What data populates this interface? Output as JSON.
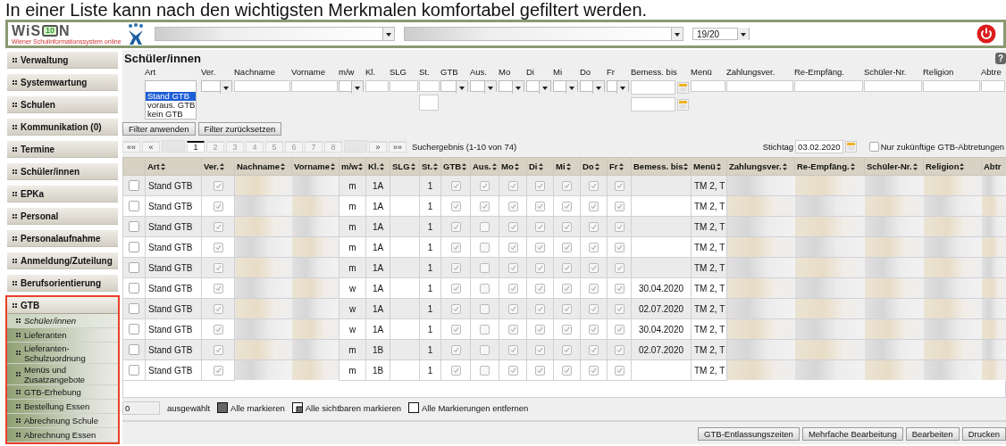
{
  "caption": "In einer Liste kann nach den wichtigsten Merkmalen komfortabel gefiltert werden.",
  "header": {
    "logo": {
      "prefix": "WiS",
      "badge": "10",
      "suffix": "N",
      "tagline": "Wiener Schulinformationssystem online"
    },
    "year": "19/20"
  },
  "sidebar": {
    "items": [
      {
        "label": "Verwaltung",
        "highlighted": false
      },
      {
        "label": "Systemwartung",
        "highlighted": false
      },
      {
        "label": "Schulen",
        "highlighted": false
      },
      {
        "label": "Kommunikation (0)",
        "highlighted": false
      },
      {
        "label": "Termine",
        "highlighted": false
      },
      {
        "label": "Schüler/innen",
        "highlighted": false
      },
      {
        "label": "EPKa",
        "highlighted": false
      },
      {
        "label": "Personal",
        "highlighted": false
      },
      {
        "label": "Personalaufnahme",
        "highlighted": false
      },
      {
        "label": "Anmeldung/Zuteilung",
        "highlighted": false
      },
      {
        "label": "Berufsorientierung",
        "highlighted": false
      },
      {
        "label": "GTB",
        "highlighted": true,
        "expanded": true,
        "children": [
          {
            "label": "Schüler/innen",
            "selected": true
          },
          {
            "label": "Lieferanten",
            "selected": false
          },
          {
            "label": "Lieferanten-Schulzuordnung",
            "selected": false
          },
          {
            "label": "Menüs und Zusatzangebote",
            "selected": false
          },
          {
            "label": "GTB-Erhebung",
            "selected": false
          },
          {
            "label": "Bestellung Essen",
            "selected": false
          },
          {
            "label": "Abrechnung Schule",
            "selected": false
          },
          {
            "label": "Abrechnung Essen",
            "selected": false
          }
        ]
      }
    ]
  },
  "page_title": "Schüler/innen",
  "help": "?",
  "filters": [
    {
      "label": "Art",
      "kind": "listbox",
      "options": [
        {
          "label": "Stand GTB",
          "selected": true
        },
        {
          "label": "voraus. GTB",
          "selected": false
        },
        {
          "label": "kein GTB",
          "selected": false
        }
      ]
    },
    {
      "label": "Ver.",
      "kind": "select"
    },
    {
      "label": "Nachname",
      "kind": "text"
    },
    {
      "label": "Vorname",
      "kind": "text"
    },
    {
      "label": "m/w",
      "kind": "select"
    },
    {
      "label": "Kl.",
      "kind": "text"
    },
    {
      "label": "SLG",
      "kind": "text"
    },
    {
      "label": "St.",
      "kind": "text_pair"
    },
    {
      "label": "GTB",
      "kind": "select"
    },
    {
      "label": "Aus.",
      "kind": "select"
    },
    {
      "label": "Mo",
      "kind": "select"
    },
    {
      "label": "Di",
      "kind": "select"
    },
    {
      "label": "Mi",
      "kind": "select"
    },
    {
      "label": "Do",
      "kind": "select"
    },
    {
      "label": "Fr",
      "kind": "select"
    },
    {
      "label": "Bemess. bis",
      "kind": "date_pair"
    },
    {
      "label": "Menü",
      "kind": "text"
    },
    {
      "label": "Zahlungsver.",
      "kind": "text"
    },
    {
      "label": "Re-Empfäng.",
      "kind": "text"
    },
    {
      "label": "Schüler-Nr.",
      "kind": "text"
    },
    {
      "label": "Religion",
      "kind": "text"
    },
    {
      "label": "Abtre",
      "kind": "text"
    }
  ],
  "filter_buttons": [
    "Filter anwenden",
    "Filter zurücksetzen"
  ],
  "pagination": {
    "first": "««",
    "prev": "«",
    "pages": [
      {
        "label": "1",
        "selected": true
      },
      {
        "label": "2",
        "selected": false
      },
      {
        "label": "3",
        "selected": false
      },
      {
        "label": "4",
        "selected": false
      },
      {
        "label": "5",
        "selected": false
      },
      {
        "label": "6",
        "selected": false
      },
      {
        "label": "7",
        "selected": false
      },
      {
        "label": "8",
        "selected": false
      }
    ],
    "next": "»",
    "last": "»»",
    "result": "Suchergebnis (1-10 von 74)"
  },
  "stichtag": {
    "label": "Stichtag",
    "value": "03.02.2020"
  },
  "future_only": {
    "label": "Nur zukünftige GTB-Abtretungen",
    "checked": false
  },
  "table": {
    "columns": [
      {
        "label": "Art",
        "kind": "text",
        "sortable": true
      },
      {
        "label": "Ver.",
        "kind": "check",
        "sortable": true
      },
      {
        "label": "Nachname",
        "kind": "blurred",
        "sortable": true
      },
      {
        "label": "Vorname",
        "kind": "blurred",
        "sortable": true
      },
      {
        "label": "m/w",
        "kind": "text",
        "sortable": true
      },
      {
        "label": "Kl.",
        "kind": "text",
        "sortable": true
      },
      {
        "label": "SLG",
        "kind": "text",
        "sortable": true
      },
      {
        "label": "St.",
        "kind": "text",
        "sortable": true
      },
      {
        "label": "GTB",
        "kind": "check",
        "sortable": true
      },
      {
        "label": "Aus.",
        "kind": "check",
        "sortable": true
      },
      {
        "label": "Mo",
        "kind": "check",
        "sortable": true
      },
      {
        "label": "Di",
        "kind": "check",
        "sortable": true
      },
      {
        "label": "Mi",
        "kind": "check",
        "sortable": true
      },
      {
        "label": "Do",
        "kind": "check",
        "sortable": true
      },
      {
        "label": "Fr",
        "kind": "check",
        "sortable": true
      },
      {
        "label": "Bemess. bis",
        "kind": "text",
        "sortable": true
      },
      {
        "label": "Menü",
        "kind": "text",
        "sortable": true
      },
      {
        "label": "Zahlungsver.",
        "kind": "blurred",
        "sortable": true
      },
      {
        "label": "Re-Empfäng.",
        "kind": "blurred",
        "sortable": true
      },
      {
        "label": "Schüler-Nr.",
        "kind": "blurred",
        "sortable": true
      },
      {
        "label": "Religion",
        "kind": "blurred",
        "sortable": true
      },
      {
        "label": "Abtr",
        "kind": "blurred"
      }
    ],
    "rows": [
      {
        "selected": false,
        "art": "Stand GTB",
        "ver": true,
        "mw": "m",
        "kl": "1A",
        "st": "1",
        "gtb": true,
        "aus": true,
        "mo": true,
        "di": true,
        "mi": true,
        "do": true,
        "fr": true,
        "menu": "TM 2, T"
      },
      {
        "selected": false,
        "art": "Stand GTB",
        "ver": true,
        "mw": "m",
        "kl": "1A",
        "st": "1",
        "gtb": true,
        "aus": true,
        "mo": true,
        "di": true,
        "mi": true,
        "do": true,
        "fr": true,
        "menu": "TM 2, T"
      },
      {
        "selected": false,
        "art": "Stand GTB",
        "ver": true,
        "mw": "m",
        "kl": "1A",
        "st": "1",
        "gtb": true,
        "aus": false,
        "mo": true,
        "di": true,
        "mi": true,
        "do": true,
        "fr": true,
        "menu": "TM 2, T"
      },
      {
        "selected": false,
        "art": "Stand GTB",
        "ver": true,
        "mw": "m",
        "kl": "1A",
        "st": "1",
        "gtb": true,
        "aus": false,
        "mo": true,
        "di": true,
        "mi": true,
        "do": true,
        "fr": true,
        "menu": "TM 2, T"
      },
      {
        "selected": false,
        "art": "Stand GTB",
        "ver": true,
        "mw": "m",
        "kl": "1A",
        "st": "1",
        "gtb": true,
        "aus": false,
        "mo": true,
        "di": true,
        "mi": true,
        "do": true,
        "fr": true,
        "menu": "TM 2, T"
      },
      {
        "selected": false,
        "art": "Stand GTB",
        "ver": true,
        "mw": "w",
        "kl": "1A",
        "st": "1",
        "gtb": true,
        "aus": false,
        "mo": true,
        "di": true,
        "mi": true,
        "do": true,
        "fr": true,
        "bemess": "30.04.2020",
        "menu": "TM 2, T"
      },
      {
        "selected": false,
        "art": "Stand GTB",
        "ver": true,
        "mw": "w",
        "kl": "1A",
        "st": "1",
        "gtb": true,
        "aus": false,
        "mo": true,
        "di": true,
        "mi": true,
        "do": true,
        "fr": true,
        "bemess": "02.07.2020",
        "menu": "TM 2, T"
      },
      {
        "selected": false,
        "art": "Stand GTB",
        "ver": true,
        "mw": "w",
        "kl": "1A",
        "st": "1",
        "gtb": true,
        "aus": false,
        "mo": true,
        "di": true,
        "mi": true,
        "do": true,
        "fr": true,
        "bemess": "30.04.2020",
        "menu": "TM 2, T"
      },
      {
        "selected": false,
        "art": "Stand GTB",
        "ver": true,
        "mw": "m",
        "kl": "1B",
        "st": "1",
        "gtb": true,
        "aus": false,
        "mo": true,
        "di": true,
        "mi": true,
        "do": true,
        "fr": true,
        "bemess": "02.07.2020",
        "menu": "TM 2, T"
      },
      {
        "selected": false,
        "art": "Stand GTB",
        "ver": true,
        "mw": "m",
        "kl": "1B",
        "st": "1",
        "gtb": true,
        "aus": false,
        "mo": true,
        "di": true,
        "mi": true,
        "do": true,
        "fr": true,
        "menu": "TM 2, T"
      }
    ]
  },
  "selection": {
    "count": "0",
    "label": "ausgewählt",
    "actions": [
      {
        "kind": "all",
        "label": "Alle markieren"
      },
      {
        "kind": "visible",
        "label": "Alle sichtbaren markieren"
      },
      {
        "kind": "none",
        "label": "Alle Markierungen entfernen"
      }
    ]
  },
  "buttons": [
    "GTB-Entlassungszeiten",
    "Mehrfache Bearbeitung",
    "Bearbeiten",
    "Drucken"
  ]
}
